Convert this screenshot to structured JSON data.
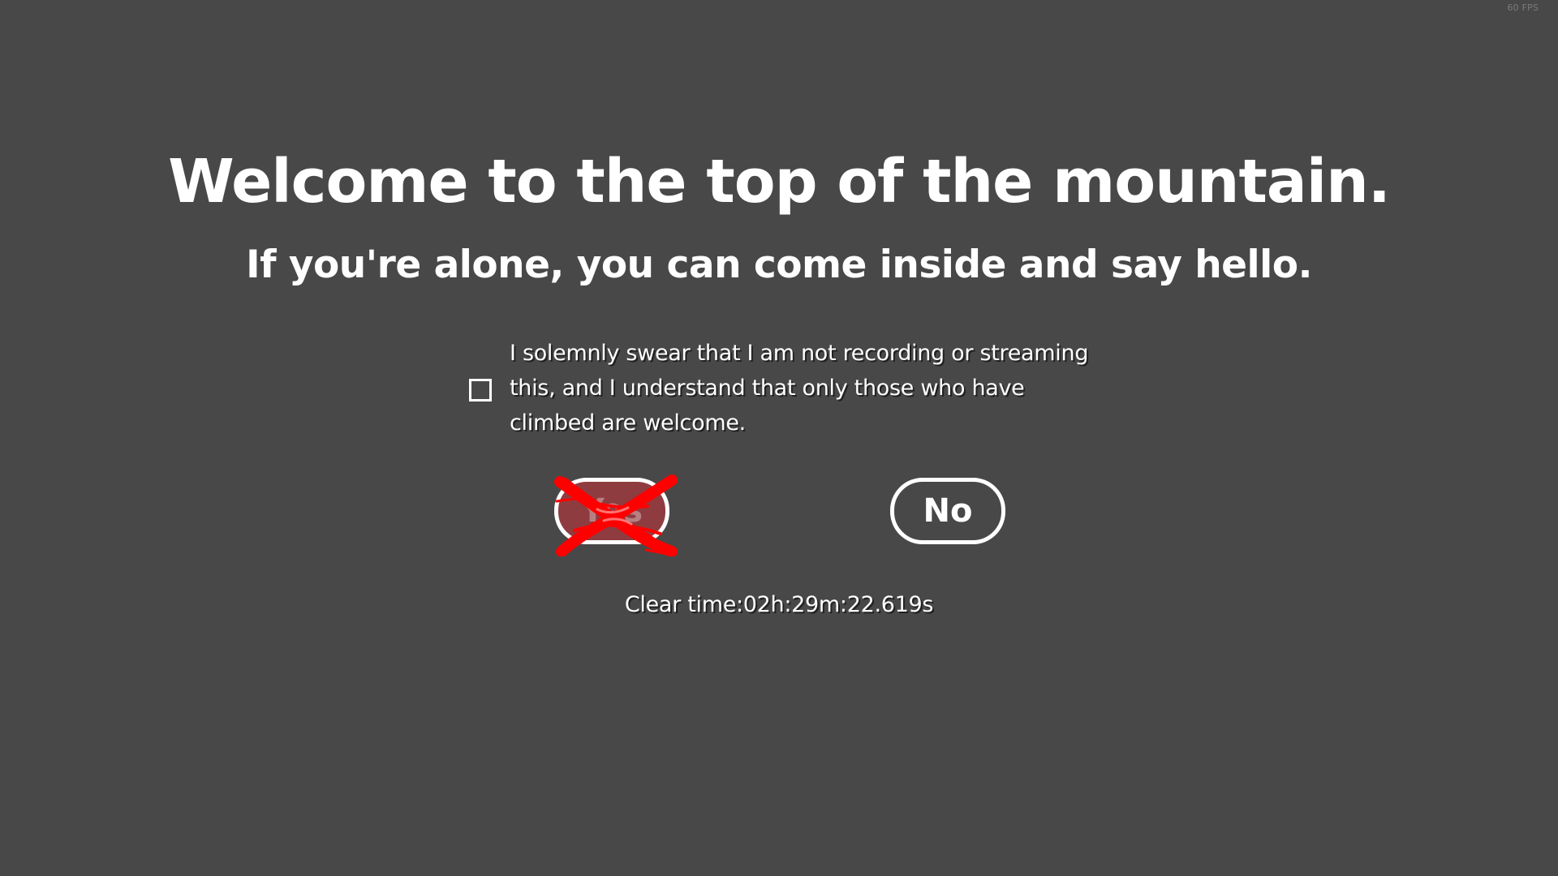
{
  "hud": {
    "fps": "60 FPS"
  },
  "dialog": {
    "title": "Welcome to the top of the mountain.",
    "subtitle": "If you're alone, you can come inside and say hello.",
    "oath": {
      "checked": false,
      "text": "I solemnly swear that I am not recording or streaming this, and I understand that only those who have climbed are welcome."
    },
    "buttons": {
      "yes": {
        "label": "Yes",
        "disabled": true,
        "mark": "red-x-scribble"
      },
      "no": {
        "label": "No"
      }
    },
    "clear_time": "Clear time:02h:29m:22.619s"
  },
  "colors": {
    "background": "#484848",
    "text": "#ffffff",
    "yes_button_fill": "#8f3c40",
    "scribble": "#ff0000",
    "fps_text": "#7a7a7a"
  }
}
